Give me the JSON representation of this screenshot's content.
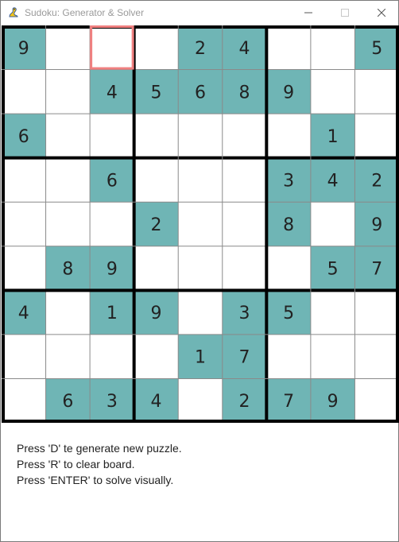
{
  "window": {
    "title": "Sudoku: Generator & Solver",
    "icon": "pygame-snake-icon",
    "controls": [
      "minimize-icon",
      "maximize-icon",
      "close-icon"
    ]
  },
  "colors": {
    "given_fill": "#6fb5b5",
    "empty_fill": "#ffffff",
    "grid_thin": "#8a8a8a",
    "grid_thick": "#000000",
    "selection": "#f08080",
    "text": "#222222"
  },
  "board": {
    "selected": {
      "row": 0,
      "col": 2
    },
    "grid": [
      [
        9,
        0,
        0,
        0,
        2,
        4,
        0,
        0,
        5
      ],
      [
        0,
        0,
        4,
        5,
        6,
        8,
        9,
        0,
        0
      ],
      [
        6,
        0,
        0,
        0,
        0,
        0,
        0,
        1,
        0
      ],
      [
        0,
        0,
        6,
        0,
        0,
        0,
        3,
        4,
        2
      ],
      [
        0,
        0,
        0,
        2,
        0,
        0,
        8,
        0,
        9
      ],
      [
        0,
        8,
        9,
        0,
        0,
        0,
        0,
        5,
        7
      ],
      [
        4,
        0,
        1,
        9,
        0,
        3,
        5,
        0,
        0
      ],
      [
        0,
        0,
        0,
        0,
        1,
        7,
        0,
        0,
        0
      ],
      [
        0,
        6,
        3,
        4,
        0,
        2,
        7,
        9,
        0
      ]
    ]
  },
  "help": {
    "line1": "Press 'D' te generate new puzzle.",
    "line2": "Press 'R' to clear board.",
    "line3": "Press 'ENTER' to solve visually."
  }
}
